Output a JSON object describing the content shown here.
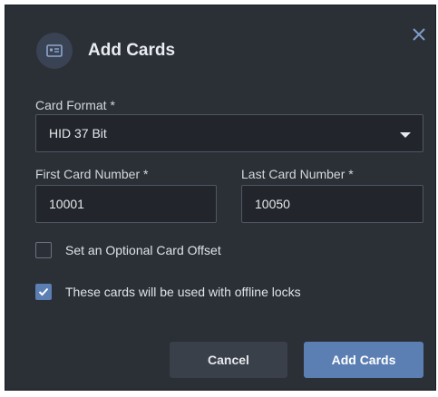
{
  "dialog": {
    "title": "Add Cards",
    "icon": "id-card-icon",
    "close_icon": "close-icon"
  },
  "form": {
    "card_format": {
      "label": "Card Format *",
      "value": "HID 37 Bit"
    },
    "first_card": {
      "label": "First Card Number *",
      "value": "10001"
    },
    "last_card": {
      "label": "Last Card Number *",
      "value": "10050"
    },
    "offset_checkbox": {
      "label": "Set an Optional Card Offset",
      "checked": false
    },
    "offline_checkbox": {
      "label": "These cards will be used with offline locks",
      "checked": true
    }
  },
  "actions": {
    "cancel_label": "Cancel",
    "submit_label": "Add Cards"
  },
  "colors": {
    "dialog_bg": "#2b2f36",
    "accent": "#5b7fb3",
    "field_bg": "#22262c"
  }
}
